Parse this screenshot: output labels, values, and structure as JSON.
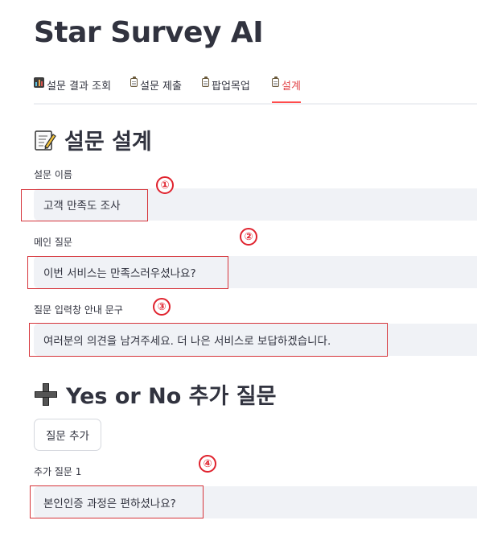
{
  "app": {
    "title": "Star Survey AI"
  },
  "tabs": [
    {
      "label": "설문 결과 조회",
      "icon": "bar-chart-icon",
      "active": false
    },
    {
      "label": "설문 제출",
      "icon": "clipboard-icon",
      "active": false
    },
    {
      "label": "팝업목업",
      "icon": "clipboard-icon",
      "active": false
    },
    {
      "label": "설계",
      "icon": "clipboard-icon",
      "active": true
    }
  ],
  "design": {
    "title": "설문 설계",
    "title_icon": "memo-icon",
    "survey_name": {
      "label": "설문 이름",
      "value": "고객 만족도 조사"
    },
    "main_question": {
      "label": "메인 질문",
      "value": "이번 서비스는 만족스러우셨나요?"
    },
    "input_guide": {
      "label": "질문 입력창 안내 문구",
      "value": "여러분의 의견을 남겨주세요. 더 나은 서비스로 보답하겠습니다."
    }
  },
  "yesno": {
    "title": "Yes or No 추가 질문",
    "title_icon": "plus-icon",
    "add_button_label": "질문 추가",
    "questions": [
      {
        "label": "추가 질문 1",
        "value": "본인인증 과정은 편하셨나요?"
      }
    ]
  },
  "markers": [
    "①",
    "②",
    "③",
    "④"
  ],
  "colors": {
    "accent": "#ff4b4b",
    "marker": "#e0232e",
    "input_bg": "#f0f2f6",
    "text": "#31333f"
  }
}
